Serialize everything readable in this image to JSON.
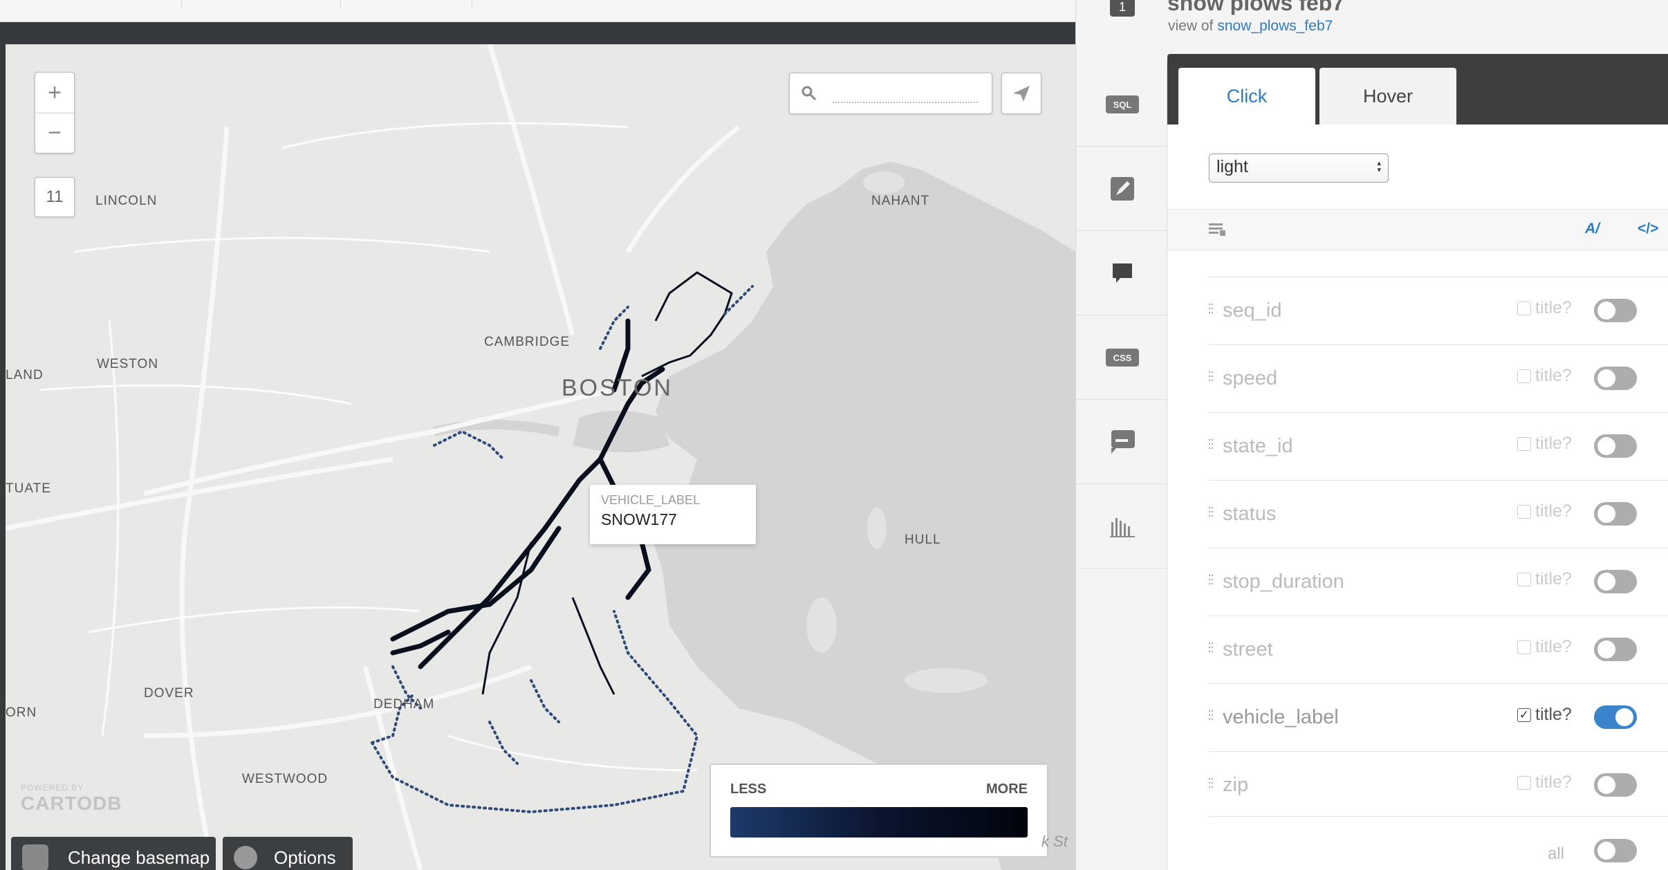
{
  "map": {
    "zoom_in": "+",
    "zoom_out": "−",
    "zoom_level": "11",
    "places": [
      "LINCOLN",
      "NAHANT",
      "CAMBRIDGE",
      "WESTON",
      "LAND",
      "BOSTON",
      "TUATE",
      "HULL",
      "DOVER",
      "DEDHAM",
      "ORN",
      "WESTWOOD"
    ],
    "tooltip": {
      "key": "VEHICLE_LABEL",
      "value": "SNOW177"
    },
    "legend": {
      "less": "LESS",
      "more": "MORE",
      "color_from": "#1d3a6b",
      "color_to": "#02040c"
    },
    "brand": {
      "powered": "POWERED BY",
      "name": "CARTODB"
    },
    "change_basemap": "Change basemap",
    "options": "Options",
    "copyright_fragment": "k St"
  },
  "panel": {
    "layer_number": "1",
    "title": "snow plows feb7",
    "view_of_label": "view of",
    "view_of_link": "snow_plows_feb7",
    "rail": [
      {
        "name": "sql-icon",
        "label": "SQL"
      },
      {
        "name": "wizard-icon",
        "label": ""
      },
      {
        "name": "infowindow-icon",
        "label": ""
      },
      {
        "name": "css-icon",
        "label": "CSS"
      },
      {
        "name": "legend-icon",
        "label": ""
      },
      {
        "name": "filters-icon",
        "label": ""
      }
    ],
    "tabs": {
      "click": "Click",
      "hover": "Hover"
    },
    "theme": "light",
    "toolbar": {
      "format": "A/",
      "code": "</>"
    },
    "fields": [
      {
        "name": "seq_id",
        "title_label": "title?",
        "checked": false,
        "on": false
      },
      {
        "name": "speed",
        "title_label": "title?",
        "checked": false,
        "on": false
      },
      {
        "name": "state_id",
        "title_label": "title?",
        "checked": false,
        "on": false
      },
      {
        "name": "status",
        "title_label": "title?",
        "checked": false,
        "on": false
      },
      {
        "name": "stop_duration",
        "title_label": "title?",
        "checked": false,
        "on": false
      },
      {
        "name": "street",
        "title_label": "title?",
        "checked": false,
        "on": false
      },
      {
        "name": "vehicle_label",
        "title_label": "title?",
        "checked": true,
        "on": true
      },
      {
        "name": "zip",
        "title_label": "title?",
        "checked": false,
        "on": false
      }
    ],
    "all_label": "all",
    "accent": "#2b7cc3",
    "toggle_on_color": "#3a85c9"
  }
}
